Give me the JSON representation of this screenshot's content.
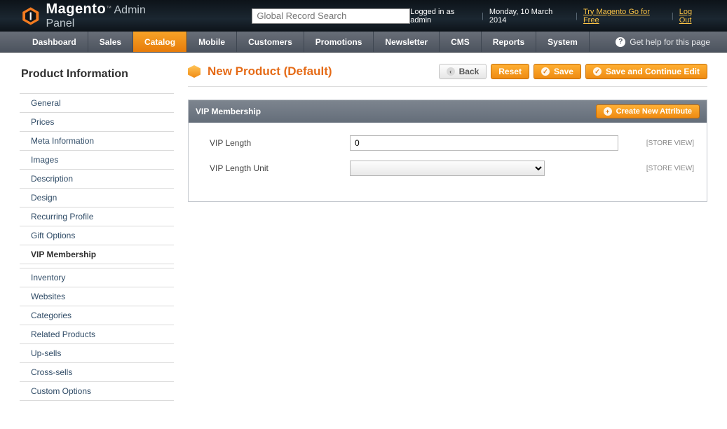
{
  "header": {
    "brand_bold": "Magento",
    "brand_tm": "™",
    "brand_sub": "Admin Panel",
    "search_placeholder": "Global Record Search",
    "logged_in": "Logged in as admin",
    "date": "Monday, 10 March 2014",
    "try_link": "Try Magento Go for Free",
    "logout": "Log Out"
  },
  "nav": {
    "items": [
      "Dashboard",
      "Sales",
      "Catalog",
      "Mobile",
      "Customers",
      "Promotions",
      "Newsletter",
      "CMS",
      "Reports",
      "System"
    ],
    "active_index": 2,
    "help": "Get help for this page"
  },
  "sidebar": {
    "title": "Product Information",
    "groups": [
      [
        "General",
        "Prices",
        "Meta Information",
        "Images",
        "Description",
        "Design",
        "Recurring Profile",
        "Gift Options",
        "VIP Membership"
      ],
      [
        "Inventory",
        "Websites",
        "Categories",
        "Related Products",
        "Up-sells",
        "Cross-sells",
        "Custom Options"
      ]
    ],
    "active": "VIP Membership"
  },
  "main": {
    "title": "New Product (Default)",
    "buttons": {
      "back": "Back",
      "reset": "Reset",
      "save": "Save",
      "save_continue": "Save and Continue Edit"
    },
    "section": {
      "title": "VIP Membership",
      "create_attr_btn": "Create New Attribute",
      "rows": [
        {
          "label": "VIP Length",
          "type": "text",
          "value": "0",
          "scope": "[STORE VIEW]"
        },
        {
          "label": "VIP Length Unit",
          "type": "select",
          "value": "",
          "scope": "[STORE VIEW]"
        }
      ]
    }
  }
}
